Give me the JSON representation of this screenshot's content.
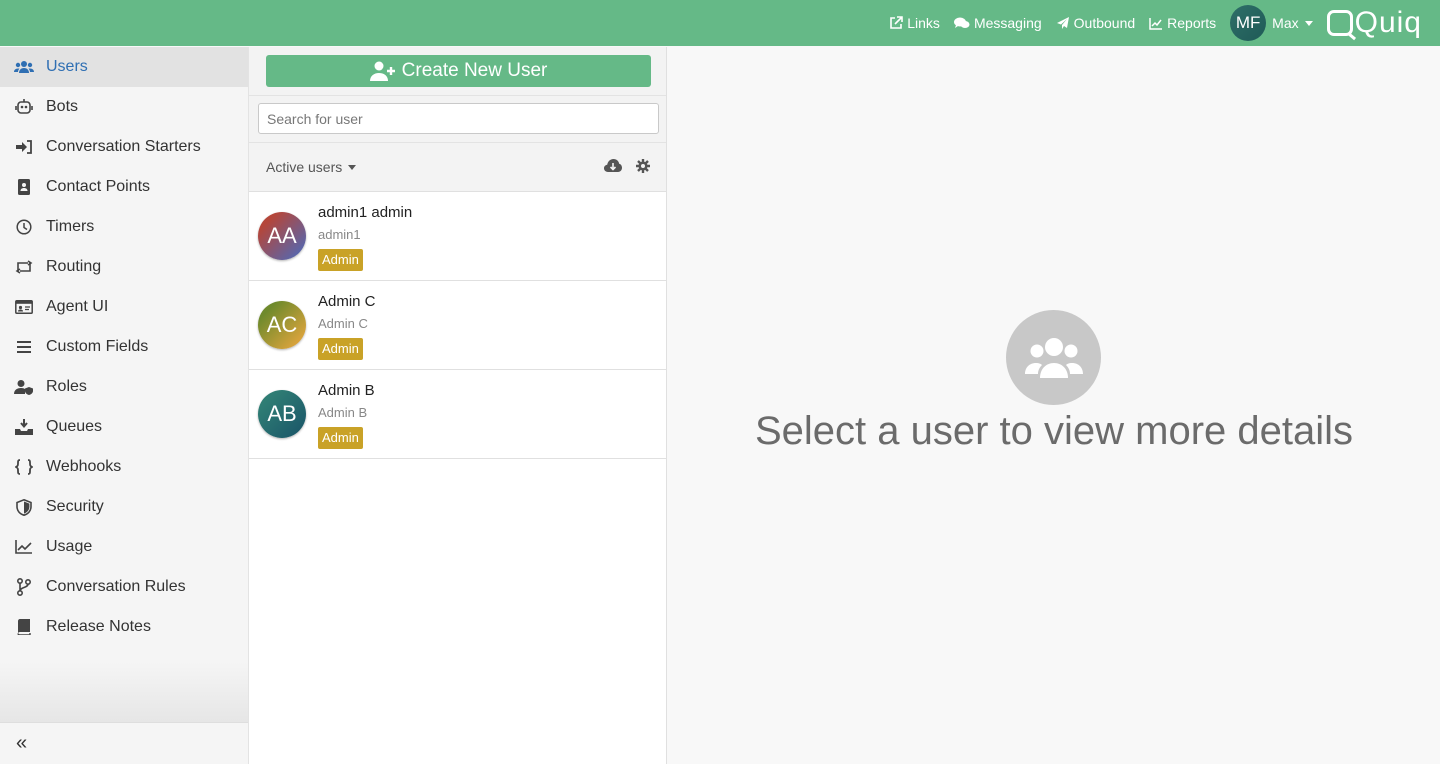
{
  "header": {
    "links": [
      {
        "label": "Links",
        "icon": "external-link-icon"
      },
      {
        "label": "Messaging",
        "icon": "comments-icon"
      },
      {
        "label": "Outbound",
        "icon": "paper-plane-icon"
      },
      {
        "label": "Reports",
        "icon": "chart-line-icon"
      }
    ],
    "user": {
      "initials": "MF",
      "name": "Max"
    },
    "logo_text": "Quiq",
    "bar_color": "#65b987"
  },
  "sidebar": {
    "items": [
      {
        "label": "Users",
        "icon": "users-icon",
        "active": true
      },
      {
        "label": "Bots",
        "icon": "robot-icon"
      },
      {
        "label": "Conversation Starters",
        "icon": "sign-in-icon"
      },
      {
        "label": "Contact Points",
        "icon": "address-book-icon"
      },
      {
        "label": "Timers",
        "icon": "clock-icon"
      },
      {
        "label": "Routing",
        "icon": "retweet-icon"
      },
      {
        "label": "Agent UI",
        "icon": "id-card-icon"
      },
      {
        "label": "Custom Fields",
        "icon": "bars-icon"
      },
      {
        "label": "Roles",
        "icon": "user-shield-icon"
      },
      {
        "label": "Queues",
        "icon": "inbox-download-icon"
      },
      {
        "label": "Webhooks",
        "icon": "braces-icon"
      },
      {
        "label": "Security",
        "icon": "shield-icon"
      },
      {
        "label": "Usage",
        "icon": "chart-area-icon"
      },
      {
        "label": "Conversation Rules",
        "icon": "code-branch-icon"
      },
      {
        "label": "Release Notes",
        "icon": "book-icon"
      }
    ],
    "collapse_glyph": "«"
  },
  "users_panel": {
    "create_label": "Create New User",
    "search_placeholder": "Search for user",
    "filter_label": "Active users",
    "users": [
      {
        "initials": "AA",
        "name": "admin1 admin",
        "login": "admin1",
        "role": "Admin"
      },
      {
        "initials": "AC",
        "name": "Admin C",
        "login": "Admin C",
        "role": "Admin"
      },
      {
        "initials": "AB",
        "name": "Admin B",
        "login": "Admin B",
        "role": "Admin"
      }
    ],
    "badge_color": "#c9a227"
  },
  "detail_panel": {
    "empty_message": "Select a user to view more details"
  }
}
